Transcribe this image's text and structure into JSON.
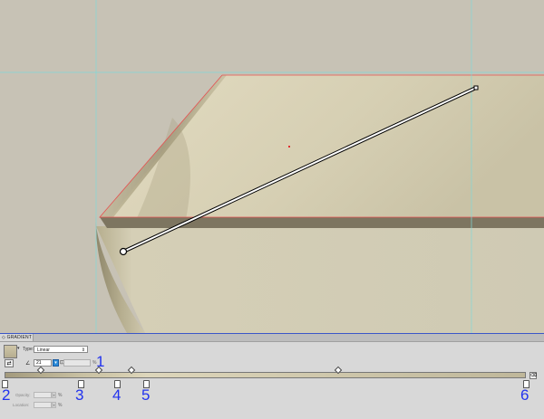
{
  "panel": {
    "tab_label": "◇ GRADIENT",
    "type_label": "Type:",
    "type_value": "Linear",
    "angle_value": "21",
    "percent_sign": "%",
    "opacity_label": "Opacity:",
    "location_label": "Location:"
  },
  "callouts": [
    "1",
    "2",
    "3",
    "4",
    "5",
    "6"
  ],
  "gradient": {
    "stops": [
      0,
      0.146,
      0.216,
      0.271,
      1
    ],
    "midpoints": [
      0.07,
      0.18,
      0.244,
      0.64
    ],
    "colors": [
      "#a39a7d",
      "#c8c0a2",
      "#d3cbad",
      "#ddd6bb",
      "#bfb79a"
    ]
  },
  "icons": {
    "swatch": "gradient-swatch-icon",
    "reverse": "reverse-gradient-icon",
    "angle": "angle-icon",
    "aspect": "aspect-ratio-icon",
    "delete": "delete-stop-icon"
  }
}
